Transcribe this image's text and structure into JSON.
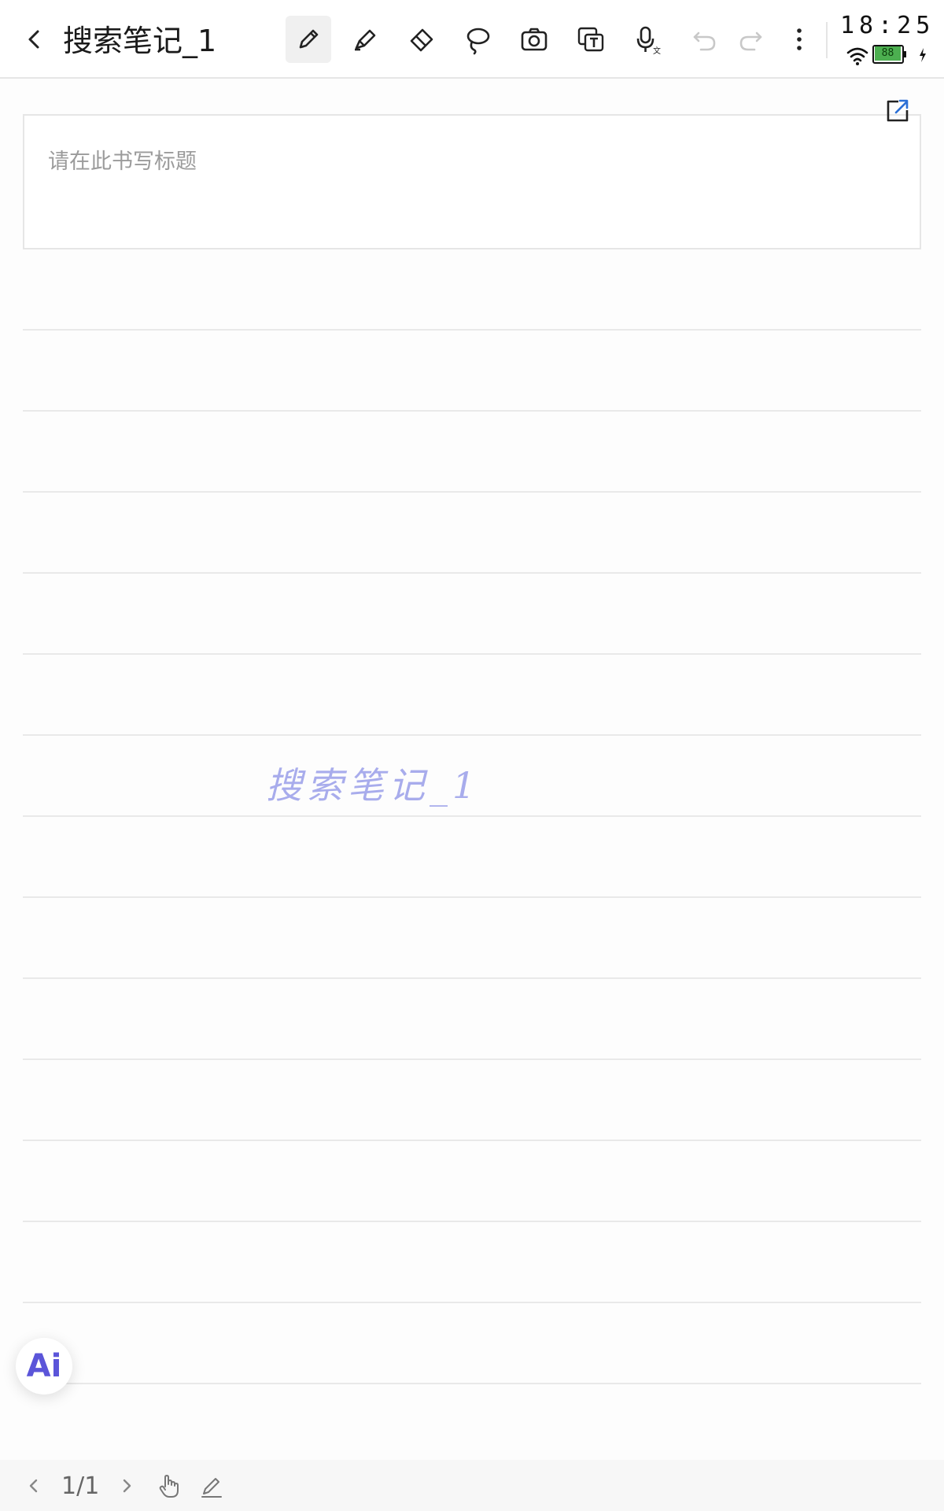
{
  "toolbar": {
    "title": "搜索笔记_1",
    "tools": [
      {
        "name": "pen",
        "icon": "pen-icon",
        "active": true
      },
      {
        "name": "highlighter",
        "icon": "highlighter-icon",
        "active": false
      },
      {
        "name": "eraser",
        "icon": "eraser-icon",
        "active": false
      },
      {
        "name": "lasso",
        "icon": "lasso-icon",
        "active": false
      },
      {
        "name": "camera",
        "icon": "camera-icon",
        "active": false
      },
      {
        "name": "text-recognition",
        "icon": "ocr-text-icon",
        "active": false
      },
      {
        "name": "voice-input",
        "icon": "microphone-icon",
        "active": false
      },
      {
        "name": "undo",
        "icon": "undo-icon",
        "enabled": false
      },
      {
        "name": "redo",
        "icon": "redo-icon",
        "enabled": false
      },
      {
        "name": "more",
        "icon": "more-vertical-icon"
      }
    ]
  },
  "status": {
    "time": "18:25",
    "battery": "88",
    "wifi_icon": "wifi-icon",
    "charging_icon": "charging-icon"
  },
  "page": {
    "title_placeholder": "请在此书写标题",
    "handwritten_text": "搜索笔记_1",
    "handwriting_color": "#a8acec",
    "export_icon": "export-icon"
  },
  "ai": {
    "label": "Ai"
  },
  "footer": {
    "page_indicator": "1/1",
    "prev_icon": "chevron-left-icon",
    "next_icon": "chevron-right-icon",
    "hand_icon": "hand-mode-icon",
    "pen_icon": "pen-mode-icon"
  },
  "colors": {
    "accent": "#5b55d9",
    "disabled": "#c8c8c8",
    "battery": "#4caf50"
  }
}
